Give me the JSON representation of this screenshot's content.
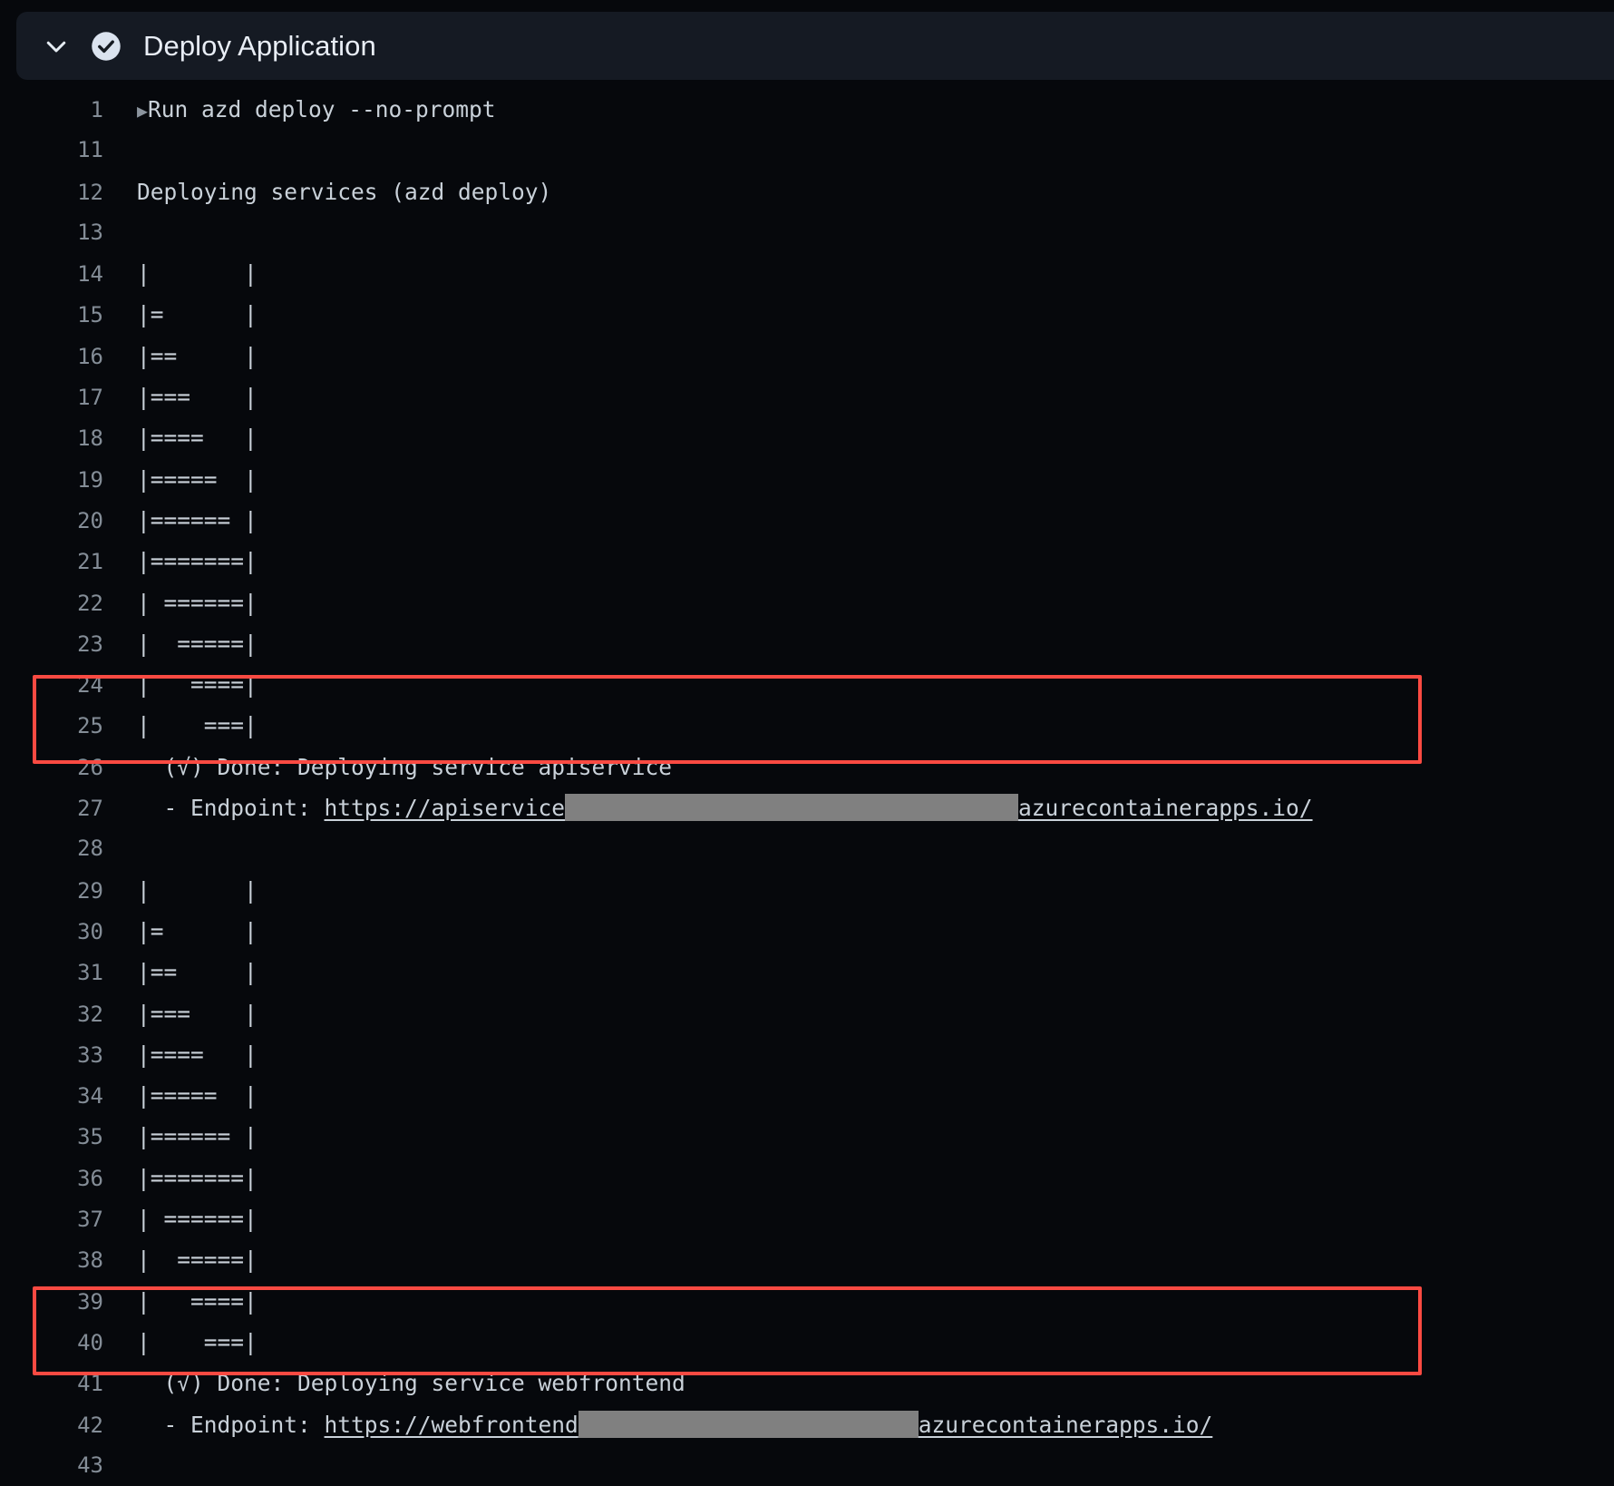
{
  "header": {
    "title": "Deploy Application",
    "chevron_icon": "chevron-down-icon",
    "status_icon": "check-circle-icon",
    "status": "success",
    "bg_color": "#151a23"
  },
  "colors": {
    "background": "#06080c",
    "text": "#c9d1d9",
    "line_number": "#848d97",
    "highlight_border": "#fa4a42",
    "redaction": "#808080"
  },
  "annotations": [
    {
      "name": "apiservice-endpoint-highlight",
      "lines": [
        26,
        27
      ]
    },
    {
      "name": "webfrontend-endpoint-highlight",
      "lines": [
        41,
        42
      ]
    }
  ],
  "log": [
    {
      "n": "1",
      "pre": "▶",
      "text": "Run azd deploy --no-prompt"
    },
    {
      "n": "11",
      "text": ""
    },
    {
      "n": "12",
      "text": "Deploying services (azd deploy)"
    },
    {
      "n": "13",
      "text": ""
    },
    {
      "n": "14",
      "text": "|       |"
    },
    {
      "n": "15",
      "text": "|=      |"
    },
    {
      "n": "16",
      "text": "|==     |"
    },
    {
      "n": "17",
      "text": "|===    |"
    },
    {
      "n": "18",
      "text": "|====   |"
    },
    {
      "n": "19",
      "text": "|=====  |"
    },
    {
      "n": "20",
      "text": "|====== |"
    },
    {
      "n": "21",
      "text": "|=======|"
    },
    {
      "n": "22",
      "text": "| ======|"
    },
    {
      "n": "23",
      "text": "|  =====|"
    },
    {
      "n": "24",
      "text": "|   ====|"
    },
    {
      "n": "25",
      "text": "|    ===|"
    },
    {
      "n": "26",
      "text": "  (√) Done: Deploying service apiservice"
    },
    {
      "n": "27",
      "link": true,
      "service": "apiservice",
      "prefix": "  - Endpoint: ",
      "url_head": "https://apiservice",
      "url_tail": "azurecontainerapps.io/",
      "redacted": true
    },
    {
      "n": "28",
      "text": ""
    },
    {
      "n": "29",
      "text": "|       |"
    },
    {
      "n": "30",
      "text": "|=      |"
    },
    {
      "n": "31",
      "text": "|==     |"
    },
    {
      "n": "32",
      "text": "|===    |"
    },
    {
      "n": "33",
      "text": "|====   |"
    },
    {
      "n": "34",
      "text": "|=====  |"
    },
    {
      "n": "35",
      "text": "|====== |"
    },
    {
      "n": "36",
      "text": "|=======|"
    },
    {
      "n": "37",
      "text": "| ======|"
    },
    {
      "n": "38",
      "text": "|  =====|"
    },
    {
      "n": "39",
      "text": "|   ====|"
    },
    {
      "n": "40",
      "text": "|    ===|"
    },
    {
      "n": "41",
      "text": "  (√) Done: Deploying service webfrontend"
    },
    {
      "n": "42",
      "link": true,
      "service": "webfrontend",
      "prefix": "  - Endpoint: ",
      "url_head": "https://webfrontend",
      "url_tail": "azurecontainerapps.io/",
      "redacted": true
    },
    {
      "n": "43",
      "text": ""
    }
  ]
}
